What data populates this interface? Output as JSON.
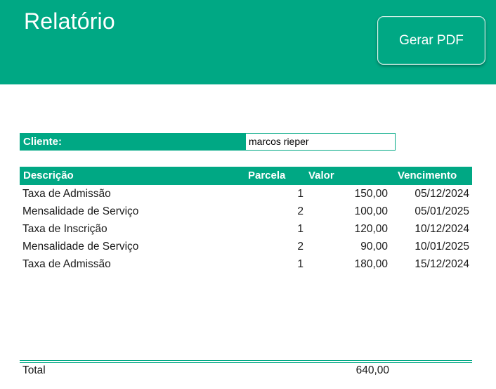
{
  "header": {
    "title": "Relatório",
    "pdf_button_label": "Gerar PDF"
  },
  "client": {
    "label": "Cliente:",
    "value": "marcos rieper"
  },
  "table": {
    "columns": {
      "descricao": "Descrição",
      "parcela": "Parcela",
      "valor": "Valor",
      "vencimento": "Vencimento"
    },
    "rows": [
      {
        "descricao": "Taxa de Admissão",
        "parcela": "1",
        "valor": "150,00",
        "vencimento": "05/12/2024"
      },
      {
        "descricao": "Mensalidade de Serviço",
        "parcela": "2",
        "valor": "100,00",
        "vencimento": "05/01/2025"
      },
      {
        "descricao": "Taxa de Inscrição",
        "parcela": "1",
        "valor": "120,00",
        "vencimento": "10/12/2024"
      },
      {
        "descricao": "Mensalidade de Serviço",
        "parcela": "2",
        "valor": "90,00",
        "vencimento": "10/01/2025"
      },
      {
        "descricao": "Taxa de Admissão",
        "parcela": "1",
        "valor": "180,00",
        "vencimento": "15/12/2024"
      }
    ]
  },
  "total": {
    "label": "Total",
    "value": "640,00"
  },
  "colors": {
    "accent": "#00A884"
  }
}
